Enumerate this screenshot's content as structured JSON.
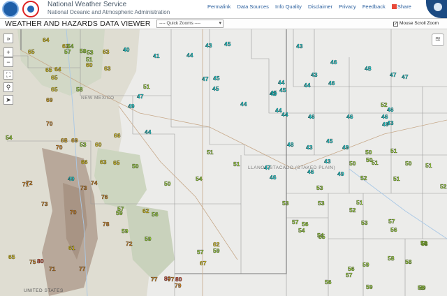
{
  "header": {
    "agency_name": "National Weather Service",
    "agency_sub": "National Oceanic and Atmospheric Administration",
    "links": [
      "Permalink",
      "Data Sources",
      "Info Quality",
      "Disclaimer",
      "Privacy",
      "Feedback"
    ],
    "share_label": "Share"
  },
  "toolbar": {
    "title": "WEATHER AND HAZARDS DATA VIEWER",
    "zoom_value": "---- Quick Zooms ----",
    "scroll_label": "Mouse Scroll Zoom"
  },
  "controls": {
    "expand_label": "»",
    "zoom_in": "+",
    "zoom_out": "−",
    "fullscreen": "⛶",
    "search": "⚲",
    "locate": "➤",
    "layers": "≋"
  },
  "map_labels": [
    "NEW MEXICO",
    "LLANO ESTACADO (STAKED PLAIN)",
    "UNITED STATES"
  ],
  "colors": {
    "cyan": "#19e3e6",
    "lime": "#a3e635",
    "green": "#63d631",
    "yellow": "#f0d519",
    "amber": "#eab420",
    "orange": "#e08a1e",
    "red": "#d8432b"
  },
  "temperatures": [
    {
      "v": "64",
      "c": "yellow"
    },
    {
      "v": "63",
      "c": "yellow"
    },
    {
      "v": "65",
      "c": "yellow"
    },
    {
      "v": "57",
      "c": "lime"
    },
    {
      "v": "54",
      "c": "lime"
    },
    {
      "v": "58",
      "c": "lime"
    },
    {
      "v": "53",
      "c": "lime"
    },
    {
      "v": "51",
      "c": "lime"
    },
    {
      "v": "63",
      "c": "yellow"
    },
    {
      "v": "40",
      "c": "cyan"
    },
    {
      "v": "65",
      "c": "yellow"
    },
    {
      "v": "64",
      "c": "yellow"
    },
    {
      "v": "41",
      "c": "cyan"
    },
    {
      "v": "44",
      "c": "cyan"
    },
    {
      "v": "43",
      "c": "cyan"
    },
    {
      "v": "45",
      "c": "cyan"
    },
    {
      "v": "45",
      "c": "cyan"
    },
    {
      "v": "60",
      "c": "yellow"
    },
    {
      "v": "63",
      "c": "yellow"
    },
    {
      "v": "65",
      "c": "yellow"
    },
    {
      "v": "47",
      "c": "cyan"
    },
    {
      "v": "58",
      "c": "lime"
    },
    {
      "v": "51",
      "c": "lime"
    },
    {
      "v": "45",
      "c": "cyan"
    },
    {
      "v": "65",
      "c": "yellow"
    },
    {
      "v": "69",
      "c": "amber"
    },
    {
      "v": "49",
      "c": "cyan"
    },
    {
      "v": "47",
      "c": "cyan"
    },
    {
      "v": "44",
      "c": "cyan"
    },
    {
      "v": "70",
      "c": "orange"
    },
    {
      "v": "44",
      "c": "cyan"
    },
    {
      "v": "54",
      "c": "lime"
    },
    {
      "v": "68",
      "c": "amber"
    },
    {
      "v": "69",
      "c": "amber"
    },
    {
      "v": "66",
      "c": "yellow"
    },
    {
      "v": "70",
      "c": "orange"
    },
    {
      "v": "53",
      "c": "lime"
    },
    {
      "v": "60",
      "c": "yellow"
    },
    {
      "v": "66",
      "c": "yellow"
    },
    {
      "v": "63",
      "c": "yellow"
    },
    {
      "v": "65",
      "c": "yellow"
    },
    {
      "v": "50",
      "c": "lime"
    },
    {
      "v": "49",
      "c": "cyan"
    },
    {
      "v": "50",
      "c": "lime"
    },
    {
      "v": "54",
      "c": "lime"
    },
    {
      "v": "51",
      "c": "lime"
    },
    {
      "v": "51",
      "c": "lime"
    },
    {
      "v": "72",
      "c": "orange"
    },
    {
      "v": "71",
      "c": "orange"
    },
    {
      "v": "73",
      "c": "orange"
    },
    {
      "v": "74",
      "c": "orange"
    },
    {
      "v": "76",
      "c": "orange"
    },
    {
      "v": "73",
      "c": "orange"
    },
    {
      "v": "57",
      "c": "lime"
    },
    {
      "v": "62",
      "c": "yellow"
    },
    {
      "v": "59",
      "c": "lime"
    },
    {
      "v": "56",
      "c": "lime"
    },
    {
      "v": "70",
      "c": "orange"
    },
    {
      "v": "78",
      "c": "orange"
    },
    {
      "v": "59",
      "c": "lime"
    },
    {
      "v": "72",
      "c": "orange"
    },
    {
      "v": "59",
      "c": "lime"
    },
    {
      "v": "67",
      "c": "yellow"
    },
    {
      "v": "62",
      "c": "yellow"
    },
    {
      "v": "59",
      "c": "lime"
    },
    {
      "v": "57",
      "c": "lime"
    },
    {
      "v": "61",
      "c": "yellow"
    },
    {
      "v": "65",
      "c": "yellow"
    },
    {
      "v": "75",
      "c": "orange"
    },
    {
      "v": "80",
      "c": "red"
    },
    {
      "v": "71",
      "c": "orange"
    },
    {
      "v": "77",
      "c": "orange"
    },
    {
      "v": "77",
      "c": "orange"
    },
    {
      "v": "80",
      "c": "red"
    },
    {
      "v": "77",
      "c": "orange"
    },
    {
      "v": "80",
      "c": "red"
    },
    {
      "v": "79",
      "c": "orange"
    },
    {
      "v": "43",
      "c": "cyan"
    },
    {
      "v": "44",
      "c": "cyan"
    },
    {
      "v": "45",
      "c": "cyan"
    },
    {
      "v": "42",
      "c": "cyan"
    },
    {
      "v": "44",
      "c": "cyan"
    },
    {
      "v": "43",
      "c": "cyan"
    },
    {
      "v": "45",
      "c": "cyan"
    },
    {
      "v": "46",
      "c": "cyan"
    },
    {
      "v": "48",
      "c": "cyan"
    },
    {
      "v": "47",
      "c": "cyan"
    },
    {
      "v": "47",
      "c": "cyan"
    },
    {
      "v": "48",
      "c": "cyan"
    },
    {
      "v": "43",
      "c": "cyan"
    },
    {
      "v": "43",
      "c": "cyan"
    },
    {
      "v": "49",
      "c": "cyan"
    },
    {
      "v": "49",
      "c": "cyan"
    },
    {
      "v": "50",
      "c": "lime"
    },
    {
      "v": "50",
      "c": "lime"
    },
    {
      "v": "50",
      "c": "lime"
    },
    {
      "v": "51",
      "c": "lime"
    },
    {
      "v": "51",
      "c": "lime"
    },
    {
      "v": "50",
      "c": "lime"
    },
    {
      "v": "51",
      "c": "lime"
    },
    {
      "v": "51",
      "c": "lime"
    },
    {
      "v": "52",
      "c": "lime"
    },
    {
      "v": "51",
      "c": "lime"
    },
    {
      "v": "53",
      "c": "lime"
    },
    {
      "v": "52",
      "c": "lime"
    },
    {
      "v": "53",
      "c": "lime"
    },
    {
      "v": "54",
      "c": "lime"
    },
    {
      "v": "54",
      "c": "lime"
    },
    {
      "v": "53",
      "c": "lime"
    },
    {
      "v": "57",
      "c": "lime"
    },
    {
      "v": "56",
      "c": "lime"
    },
    {
      "v": "55",
      "c": "lime"
    },
    {
      "v": "53",
      "c": "lime"
    },
    {
      "v": "57",
      "c": "lime"
    },
    {
      "v": "56",
      "c": "lime"
    },
    {
      "v": "58",
      "c": "lime"
    },
    {
      "v": "58",
      "c": "lime"
    },
    {
      "v": "58",
      "c": "lime"
    },
    {
      "v": "59",
      "c": "lime"
    },
    {
      "v": "56",
      "c": "lime"
    },
    {
      "v": "57",
      "c": "lime"
    },
    {
      "v": "56",
      "c": "lime"
    },
    {
      "v": "58",
      "c": "lime"
    },
    {
      "v": "59",
      "c": "lime"
    },
    {
      "v": "59",
      "c": "lime"
    },
    {
      "v": "58",
      "c": "lime"
    },
    {
      "v": "52",
      "c": "lime"
    },
    {
      "v": "52",
      "c": "lime"
    },
    {
      "v": "44",
      "c": "cyan"
    },
    {
      "v": "44",
      "c": "cyan"
    },
    {
      "v": "46",
      "c": "cyan"
    },
    {
      "v": "46",
      "c": "cyan"
    },
    {
      "v": "46",
      "c": "cyan"
    },
    {
      "v": "43",
      "c": "cyan"
    },
    {
      "v": "46",
      "c": "cyan"
    },
    {
      "v": "46",
      "c": "cyan"
    },
    {
      "v": "49",
      "c": "cyan"
    },
    {
      "v": "45",
      "c": "cyan"
    },
    {
      "v": "47",
      "c": "cyan"
    },
    {
      "v": "46",
      "c": "cyan"
    },
    {
      "v": "46",
      "c": "cyan"
    },
    {
      "v": "43",
      "c": "cyan"
    },
    {
      "v": "46",
      "c": "cyan"
    },
    {
      "v": "46",
      "c": "cyan"
    },
    {
      "v": "48",
      "c": "cyan"
    },
    {
      "v": "45",
      "c": "cyan"
    }
  ]
}
